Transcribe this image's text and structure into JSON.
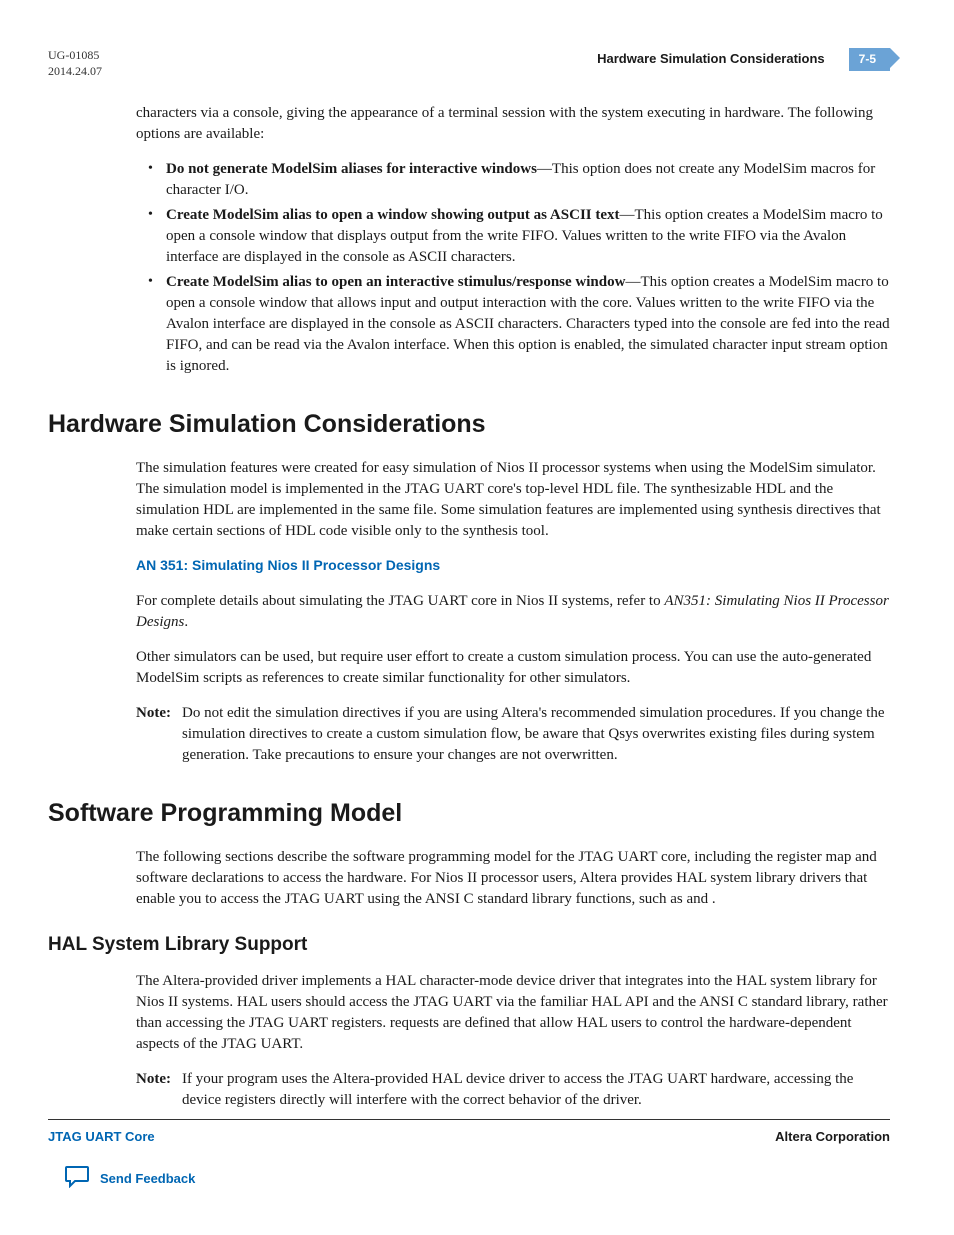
{
  "header": {
    "docId": "UG-01085",
    "date": "2014.24.07",
    "title": "Hardware Simulation Considerations",
    "pageNum": "7-5"
  },
  "introPara": "characters via a console, giving the appearance of a terminal session with the system executing in hardware. The following options are available:",
  "bullets": [
    {
      "bold": "Do not generate ModelSim aliases for interactive windows",
      "rest": "—This option does not create any ModelSim macros for character I/O."
    },
    {
      "bold": "Create ModelSim alias to open a window showing output as ASCII text",
      "rest": "—This option creates a ModelSim macro to open a console window that displays output from the write FIFO. Values written to the write FIFO via the Avalon interface are displayed in the console as ASCII characters."
    },
    {
      "bold": "Create ModelSim alias to open an interactive stimulus/response window",
      "rest": "—This option creates a ModelSim macro to open a console window that allows input and output interaction with the core. Values written to the write FIFO via the Avalon interface are displayed in the console as ASCII characters. Characters typed into the console are fed into the read FIFO, and can be read via the Avalon interface. When this option is enabled, the simulated character input stream option is ignored."
    }
  ],
  "section1": {
    "heading": "Hardware Simulation Considerations",
    "para1a": "The simulation features were created for easy simulation of Nios II processor systems when using the ModelSim simulator. The simulation model is implemented in the JTAG UART core's top-level HDL file. The synthesizable HDL and the simulation HDL are implemented in the same file. Some simulation features are implemented using ",
    "para1b": " synthesis directives that make certain sections of HDL code visible only to the synthesis tool.",
    "link": "AN 351: Simulating Nios II Processor Designs",
    "para2a": "For complete details about simulating the JTAG UART core in Nios II systems, refer to ",
    "para2b": "AN351: Simulating Nios II Processor Designs",
    "para2c": ".",
    "para3": "Other simulators can be used, but require user effort to create a custom simulation process. You can use the auto-generated ModelSim scripts as references to create similar functionality for other simulators.",
    "noteLabel": "Note:",
    "noteText": "Do not edit the simulation directives if you are using Altera's recommended simulation procedures. If you change the simulation directives to create a custom simulation flow, be aware that Qsys overwrites existing files during system generation. Take precautions to ensure your changes are not overwritten."
  },
  "section2": {
    "heading": "Software Programming Model",
    "para1a": "The following sections describe the software programming model for the JTAG UART core, including the register map and software declarations to access the hardware. For Nios II processor users, Altera provides HAL system library drivers that enable you to access the JTAG UART using the ANSI C standard library functions, such as ",
    "para1b": " and ",
    "para1c": ".",
    "sub": {
      "heading": "HAL System Library Support",
      "para1a": "The Altera-provided driver implements a HAL character-mode device driver that integrates into the HAL system library for Nios II systems. HAL users should access the JTAG UART via the familiar HAL API and the ANSI C standard library, rather than accessing the JTAG UART registers. ",
      "para1b": " requests are defined that allow HAL users to control the hardware-dependent aspects of the JTAG UART.",
      "noteLabel": "Note:",
      "noteText": "If your program uses the Altera-provided HAL device driver to access the JTAG UART hardware, accessing the device registers directly will interfere with the correct behavior of the driver."
    }
  },
  "footer": {
    "left": "JTAG UART Core",
    "right": "Altera Corporation",
    "feedback": "Send Feedback"
  }
}
